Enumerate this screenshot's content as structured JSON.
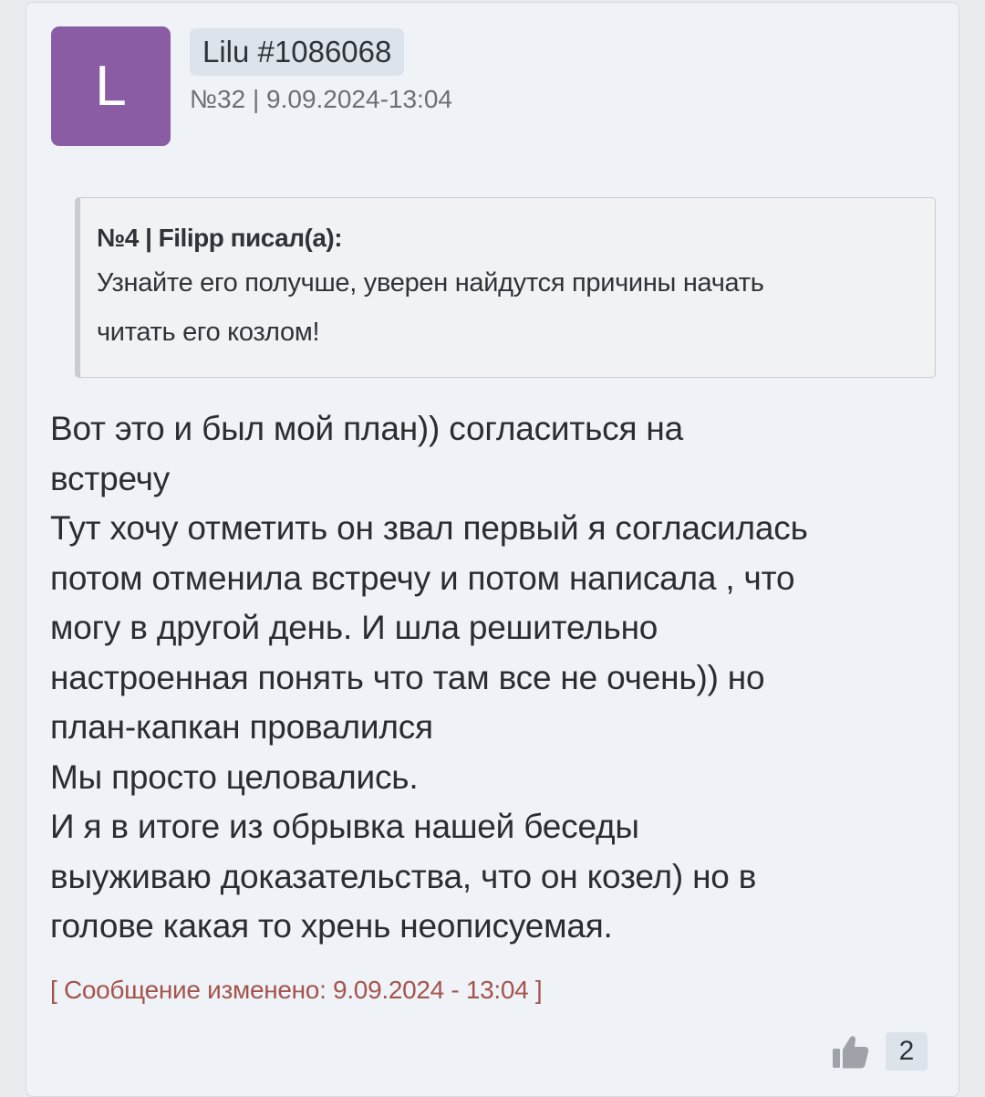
{
  "post": {
    "avatar_letter": "L",
    "author": "Lilu #1086068",
    "meta": "№32 | 9.09.2024-13:04",
    "quote": {
      "header": "№4 | Filipp писал(а):",
      "lines": [
        "Узнайте его получше, уверен найдутся причины начать",
        "читать его козлом!"
      ]
    },
    "body_lines": [
      "Вот это и был мой план)) согласиться на",
      "встречу",
      "Тут хочу отметить он звал первый я согласилась",
      "потом отменила встречу и потом написала , что",
      "могу в другой день. И шла решительно",
      "настроенная понять что там все не очень)) но",
      "план-капкан провалился",
      "Мы просто целовались.",
      "И я в итоге из обрывка нашей беседы",
      "выуживаю доказательства, что он козел) но в",
      "голове какая то хрень неописуемая."
    ],
    "edited_note": "[ Сообщение изменено: 9.09.2024 - 13:04 ]",
    "likes": {
      "icon": "thumbs-up-icon",
      "count": "2"
    }
  },
  "colors": {
    "avatar_bg": "#8a5ca3",
    "card_bg": "#eff3f7",
    "edited_note": "#a4544d",
    "badge_bg": "#dde3ea"
  }
}
